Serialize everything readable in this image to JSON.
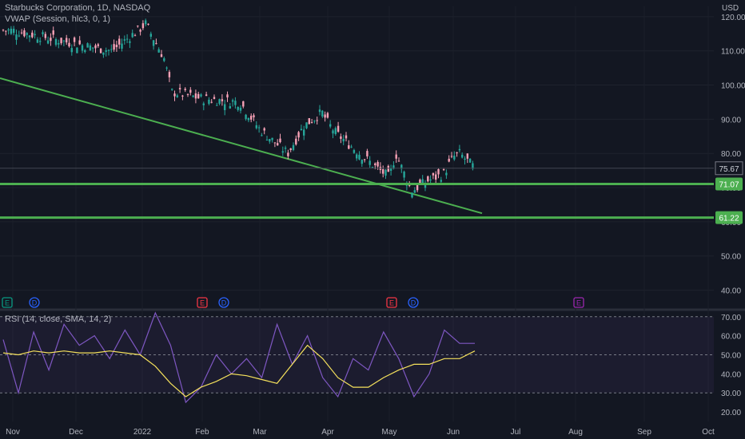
{
  "chart_data": [
    {
      "type": "candlestick",
      "title": "Starbucks Corporation, 1D, NASDAQ",
      "indicator_label": "VWAP (Session, hlc3, 0, 1)",
      "currency": "USD",
      "ylim": [
        35,
        123
      ],
      "y_ticks": [
        120,
        110,
        100,
        90,
        80,
        70,
        60,
        50,
        40
      ],
      "x_ticks": [
        "Nov",
        "Dec",
        "2022",
        "Feb",
        "Mar",
        "Apr",
        "May",
        "Jun",
        "Jul",
        "Aug",
        "Sep",
        "Oct"
      ],
      "last_price": 75.67,
      "horizontal_levels": [
        71.07,
        61.22
      ],
      "trendline": {
        "from": {
          "x": "Nov",
          "y": 102
        },
        "to": {
          "x": "Jun",
          "y": 62.5
        }
      },
      "close_series": [
        {
          "x": "Nov",
          "y": 116
        },
        {
          "x": "Dec",
          "y": 112
        },
        {
          "x": "2022",
          "y": 117
        },
        {
          "x": "Feb",
          "y": 96
        },
        {
          "x": "Mar",
          "y": 87
        },
        {
          "x": "Apr",
          "y": 89
        },
        {
          "x": "May",
          "y": 73
        },
        {
          "x": "Jun",
          "y": 79
        }
      ],
      "event_markers": [
        {
          "label": "E",
          "color": "#089981"
        },
        {
          "label": "D",
          "color": "#2962ff"
        },
        {
          "label": "E",
          "color": "#f23645"
        },
        {
          "label": "D",
          "color": "#2962ff"
        },
        {
          "label": "E",
          "color": "#f23645"
        },
        {
          "label": "D",
          "color": "#2962ff"
        },
        {
          "label": "E",
          "color": "#9c27b0"
        }
      ],
      "colors": {
        "up": "#26a69a",
        "down": "#f7a1b6",
        "level": "#4caf50",
        "background": "#131722"
      }
    },
    {
      "type": "line",
      "title": "RSI (14, close, SMA, 14, 2)",
      "ylim": [
        15,
        72
      ],
      "y_ticks": [
        70,
        60,
        50,
        40,
        30,
        20
      ],
      "bands": [
        70,
        50,
        30
      ],
      "series": [
        {
          "name": "RSI",
          "color": "#7e57c2",
          "values": [
            58,
            30,
            62,
            42,
            66,
            55,
            60,
            48,
            63,
            50,
            72,
            55,
            25,
            33,
            50,
            40,
            48,
            38,
            66,
            45,
            60,
            38,
            28,
            48,
            42,
            62,
            48,
            28,
            40,
            63,
            56,
            56
          ]
        },
        {
          "name": "SMA",
          "color": "#f5e15c",
          "values": [
            51,
            50,
            52,
            51,
            52,
            51,
            51,
            52,
            51,
            50,
            44,
            35,
            28,
            33,
            36,
            40,
            39,
            37,
            35,
            45,
            55,
            48,
            38,
            33,
            33,
            38,
            42,
            45,
            45,
            48,
            48,
            52
          ]
        }
      ]
    }
  ]
}
